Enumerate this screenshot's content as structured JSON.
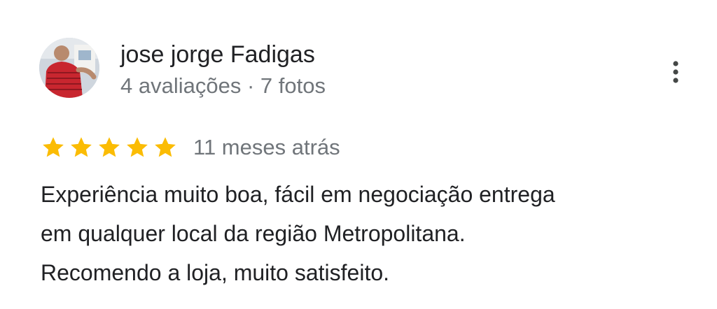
{
  "review": {
    "author_name": "jose jorge Fadigas",
    "author_meta": "4 avaliações · 7 fotos",
    "rating": 5,
    "rating_max": 5,
    "date": "11 meses atrás",
    "text_lines": [
      "Experiência muito boa, fácil em negociação entrega",
      "em qualquer local da região Metropolitana.",
      "Recomendo a loja, muito satisfeito."
    ]
  },
  "icons": {
    "avatar": "profile-photo",
    "menu": "more-vert-icon",
    "star": "star-icon"
  },
  "colors": {
    "star": "#fbbc04",
    "text_primary": "#202124",
    "text_secondary": "#70757a"
  }
}
